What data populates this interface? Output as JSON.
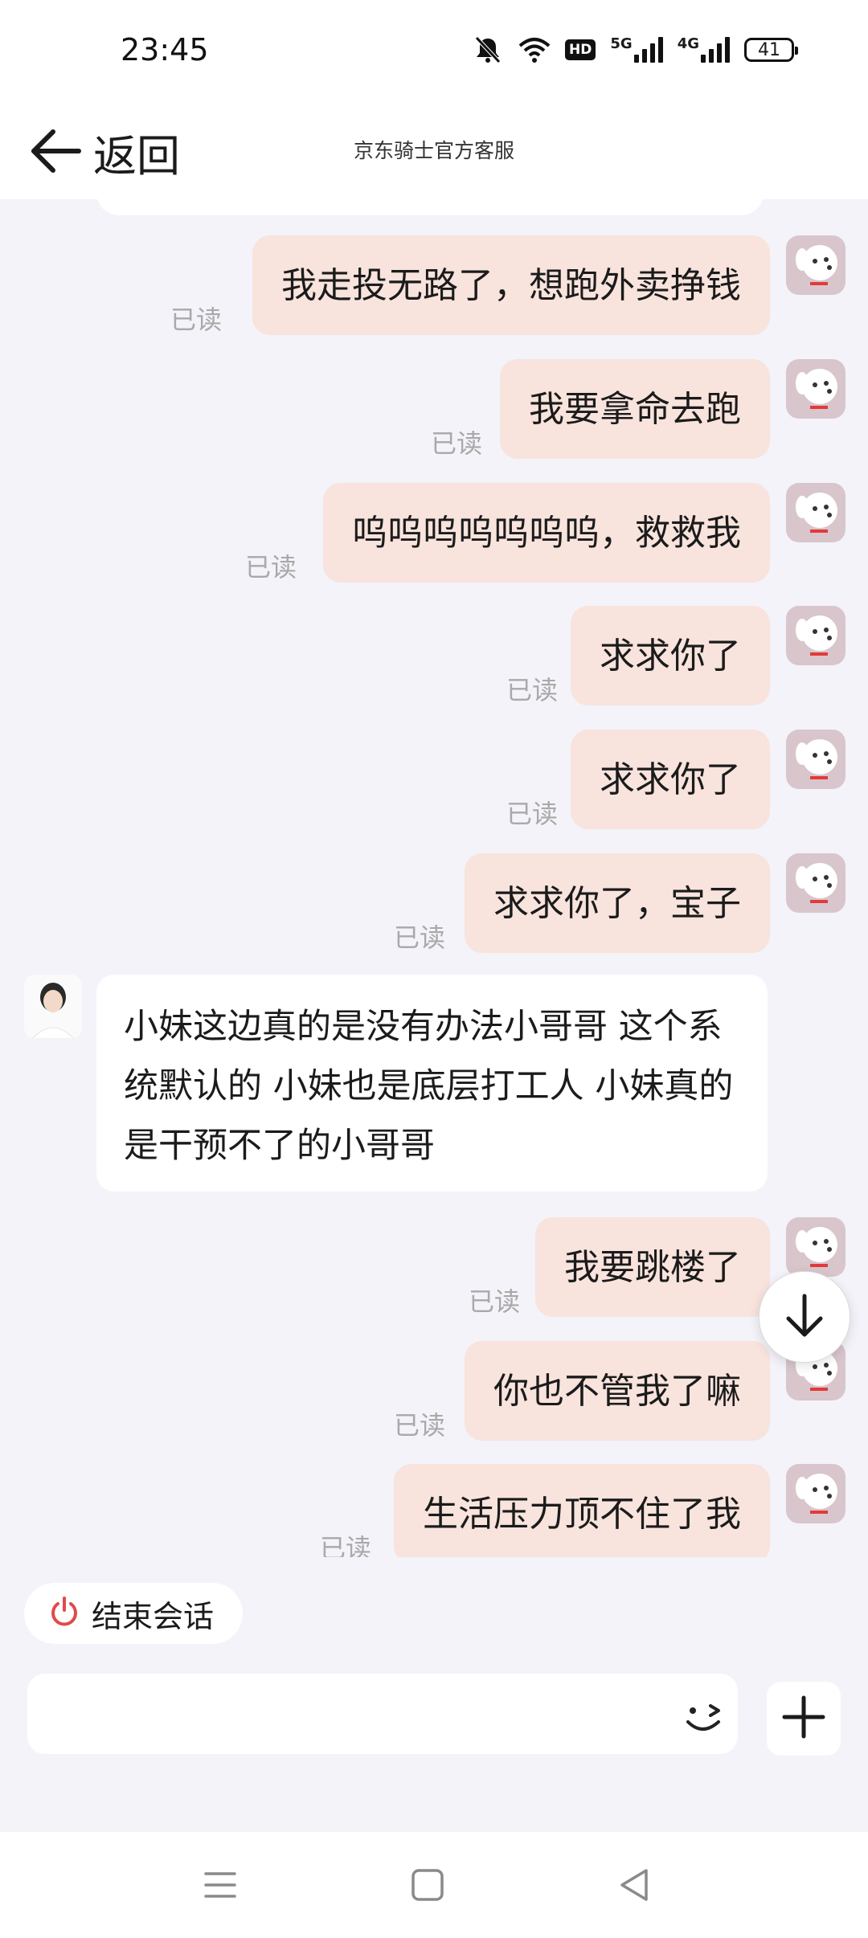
{
  "status_bar": {
    "time": "23:45",
    "battery": "41",
    "sig1_label": "5G",
    "sig2_label": "4G",
    "hd_label": "HD"
  },
  "header": {
    "back_label": "返回",
    "title": "京东骑士官方客服"
  },
  "messages": [
    {
      "text": "我走投无路了，想跑外卖挣钱",
      "read": "已读"
    },
    {
      "text": "我要拿命去跑",
      "read": "已读"
    },
    {
      "text": "呜呜呜呜呜呜呜，救救我",
      "read": "已读"
    },
    {
      "text": "求求你了",
      "read": "已读"
    },
    {
      "text": "求求你了",
      "read": "已读"
    },
    {
      "text": "求求你了，宝子",
      "read": "已读"
    },
    {
      "text": "小妹这边真的是没有办法小哥哥 这个系统默认的 小妹也是底层打工人 小妹真的是干预不了的小哥哥"
    },
    {
      "text": "我要跳楼了",
      "read": "已读"
    },
    {
      "text": "你也不管我了嘛",
      "read": "已读"
    },
    {
      "text": "生活压力顶不住了我",
      "read": "已读"
    }
  ],
  "end_session": {
    "label": "结束会话",
    "icon": "power-icon"
  },
  "input": {
    "placeholder": ""
  },
  "colors": {
    "outgoing_bubble": "#f8e3dd",
    "background": "#f3f3f9",
    "end_icon": "#e24a4a"
  }
}
